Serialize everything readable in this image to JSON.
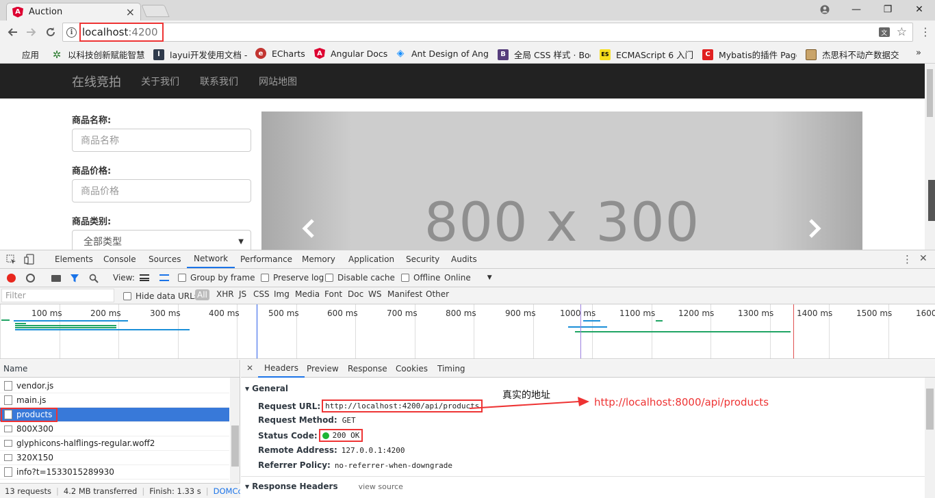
{
  "tab": {
    "title": "Auction",
    "close": "×"
  },
  "window_controls": {
    "minimize": "—",
    "maximize": "❐",
    "close": "✕"
  },
  "address": {
    "host": "localhost",
    "port": ":4200"
  },
  "bookmarks": [
    {
      "label": "应用",
      "icon": "apps-grid-icon"
    },
    {
      "label": "以科技创新赋能智慧",
      "icon": "green-gear-icon"
    },
    {
      "label": "layui开发使用文档 -",
      "icon": "layui-icon"
    },
    {
      "label": "ECharts",
      "icon": "echarts-icon"
    },
    {
      "label": "Angular Docs",
      "icon": "angular-icon"
    },
    {
      "label": "Ant Design of Angu",
      "icon": "ant-design-icon"
    },
    {
      "label": "全局 CSS 样式 · Boo",
      "icon": "bootstrap-icon"
    },
    {
      "label": "ECMAScript 6 入门",
      "icon": "es-icon"
    },
    {
      "label": "Mybatis的插件 Page",
      "icon": "c-red-icon"
    },
    {
      "label": "杰思科不动产数据交",
      "icon": "image-icon"
    }
  ],
  "navbar": {
    "brand": "在线竞拍",
    "links": [
      "关于我们",
      "联系我们",
      "网站地图"
    ]
  },
  "search_form": {
    "name_label": "商品名称:",
    "name_placeholder": "商品名称",
    "price_label": "商品价格:",
    "price_placeholder": "商品价格",
    "category_label": "商品类别:",
    "category_value": "全部类型"
  },
  "carousel": {
    "text": "800 x 300"
  },
  "devtools": {
    "tabs": [
      "Elements",
      "Console",
      "Sources",
      "Network",
      "Performance",
      "Memory",
      "Application",
      "Security",
      "Audits"
    ],
    "active_tab": "Network",
    "toolbar": {
      "view_label": "View:",
      "group_by_frame": "Group by frame",
      "preserve_log": "Preserve log",
      "disable_cache": "Disable cache",
      "offline": "Offline",
      "throttle": "Online"
    },
    "filter": {
      "placeholder": "Filter",
      "hide_data_urls": "Hide data URLs",
      "types": [
        "All",
        "XHR",
        "JS",
        "CSS",
        "Img",
        "Media",
        "Font",
        "Doc",
        "WS",
        "Manifest",
        "Other"
      ]
    },
    "timeline_ticks": [
      "100 ms",
      "200 ms",
      "300 ms",
      "400 ms",
      "500 ms",
      "600 ms",
      "700 ms",
      "800 ms",
      "900 ms",
      "1000 ms",
      "1100 ms",
      "1200 ms",
      "1300 ms",
      "1400 ms",
      "1500 ms",
      "1600"
    ],
    "name_header": "Name",
    "requests": [
      "vendor.js",
      "main.js",
      "products",
      "800X300",
      "glyphicons-halflings-regular.woff2",
      "320X150",
      "info?t=1533015289930"
    ],
    "selected_request": "products",
    "detail_tabs": [
      "Headers",
      "Preview",
      "Response",
      "Cookies",
      "Timing"
    ],
    "general": {
      "title": "General",
      "request_url_key": "Request URL:",
      "request_url": "http://localhost:4200/api/products",
      "request_method_key": "Request Method:",
      "request_method": "GET",
      "status_code_key": "Status Code:",
      "status_code": "200 OK",
      "remote_address_key": "Remote Address:",
      "remote_address": "127.0.0.1:4200",
      "referrer_policy_key": "Referrer Policy:",
      "referrer_policy": "no-referrer-when-downgrade"
    },
    "response_headers": {
      "title": "Response Headers",
      "view_source": "view source"
    },
    "status_bar": {
      "requests": "13 requests",
      "transferred": "4.2 MB transferred",
      "finish": "Finish: 1.33 s",
      "dom": "DOMConten"
    }
  },
  "annotation": {
    "label": "真实的地址",
    "real_url": "http://localhost:8000/api/products"
  },
  "colors": {
    "accent_red": "#e33333",
    "navbar": "#222222",
    "selected_row": "#3879d9",
    "network_blue": "#1a73e8"
  }
}
